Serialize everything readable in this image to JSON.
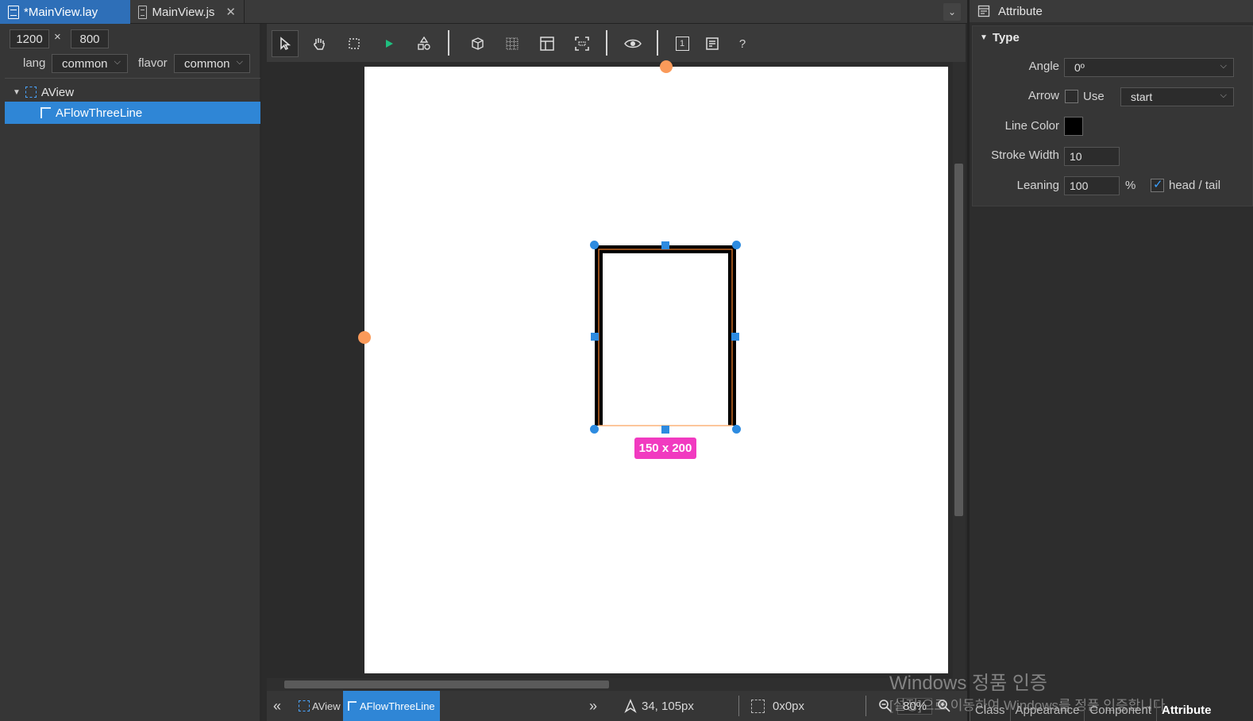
{
  "tabs": [
    {
      "label": "*MainView.lay",
      "active": true
    },
    {
      "label": "MainView.js",
      "active": false
    }
  ],
  "left": {
    "width": "1200",
    "height": "800",
    "times": "×",
    "lang_label": "lang",
    "lang_value": "common",
    "flavor_label": "flavor",
    "flavor_value": "common",
    "tree": [
      {
        "label": "AView"
      },
      {
        "label": "AFlowThreeLine",
        "selected": true
      }
    ]
  },
  "toolbar": {
    "help": "?",
    "one": "1"
  },
  "canvas": {
    "size_badge": "150 x 200"
  },
  "status": {
    "crumb1": "AView",
    "crumb2": "AFlowThreeLine",
    "coords": "34, 105px",
    "selection": "0x0px",
    "zoom": "80%"
  },
  "attr": {
    "header": "Attribute",
    "section": "Type",
    "angle_label": "Angle",
    "angle_value": "0º",
    "arrow_label": "Arrow",
    "arrow_use": "Use",
    "arrow_value": "start",
    "linecolor_label": "Line Color",
    "linecolor_value": "#000000",
    "stroke_label": "Stroke Width",
    "stroke_value": "10",
    "leaning_label": "Leaning",
    "leaning_value": "100",
    "leaning_unit": "%",
    "headtail_label": "head / tail"
  },
  "bottom_tabs": [
    "Class",
    "Appearance",
    "Component",
    "Attribute"
  ],
  "watermark": {
    "line1": "Windows 정품 인증",
    "line2": "[설정]으로 이동하여 Windows를 정품 인증합니다."
  }
}
